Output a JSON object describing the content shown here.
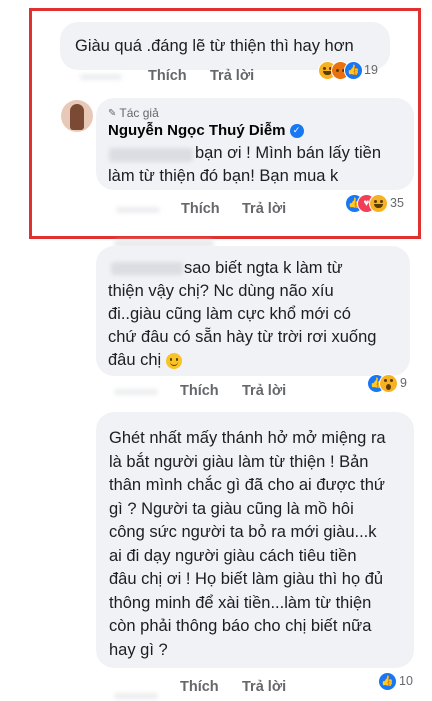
{
  "theme": {
    "highlight_color": "#e03131",
    "action_color": "#65676b",
    "like_color": "#1877f2",
    "bubble_color": "#f0f2f5"
  },
  "comment1": {
    "text": "Giàu quá .đáng lẽ từ thiện  thì hay hơn",
    "like_label": "Thích",
    "reply_label": "Trả lời",
    "reaction_count": "19",
    "reactions": [
      "haha-icon",
      "angry-icon",
      "like-icon"
    ]
  },
  "comment2": {
    "author_badge": "Tác giả",
    "author_name": "Nguyễn Ngọc Thuý Diễm",
    "text_line1": "bạn ơi ! Mình bán lấy tiền",
    "text_line2": "làm từ thiện đó bạn! Bạn mua k",
    "like_label": "Thích",
    "reply_label": "Trả lời",
    "reaction_count": "35",
    "reactions": [
      "like-icon",
      "heart-icon",
      "haha-icon"
    ]
  },
  "comment3": {
    "line1": "sao biết ngta k làm từ",
    "line2": "thiện vậy chị? Nc dùng não xíu",
    "line3": "đi..giàu cũng làm cực khổ mới có",
    "line4": "chứ đâu có sẵn hày từ trời rơi xuống",
    "line5": "đâu chị",
    "like_label": "Thích",
    "reply_label": "Trả lời",
    "reaction_count": "9",
    "reactions": [
      "like-icon",
      "wow-icon"
    ]
  },
  "comment4": {
    "lines": [
      "Ghét nhất mấy thánh hở mở miệng ra",
      "là bắt người giàu làm từ thiện ! Bản",
      "thân mình chắc gì đã cho ai được thứ",
      "gì ? Người ta giàu cũng là mồ hôi",
      "công sức người ta bỏ ra mới giàu...k",
      "ai đi dạy người giàu cách tiêu tiền",
      "đâu chị ơi ! Họ biết làm giàu thì họ đủ",
      "thông minh để xài tiền...làm từ thiện",
      "còn phải thông báo cho chị biết nữa",
      "hay gì ?"
    ],
    "like_label": "Thích",
    "reply_label": "Trả lời",
    "reaction_count": "10",
    "reactions": [
      "like-icon"
    ]
  }
}
